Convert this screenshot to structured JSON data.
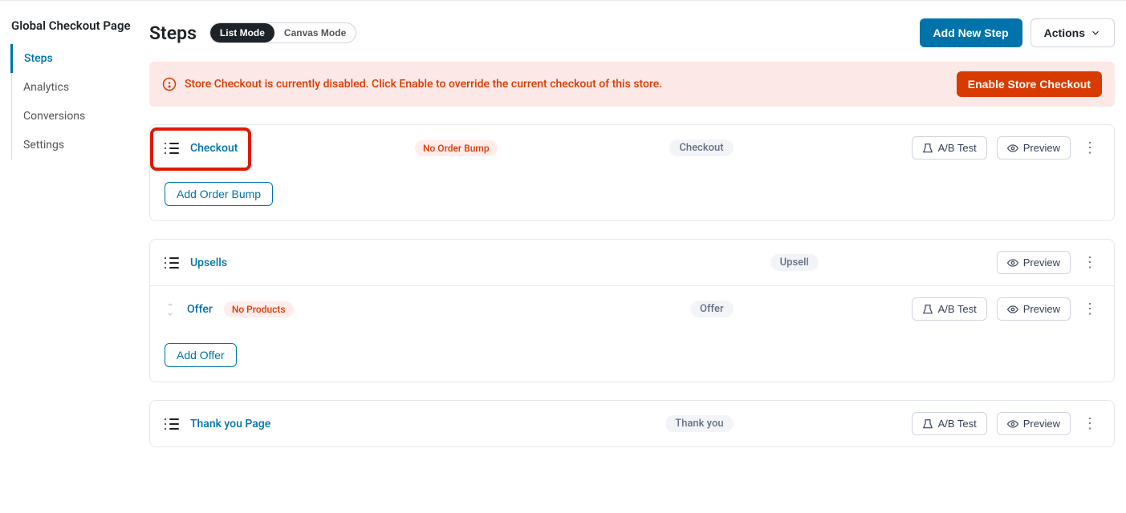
{
  "sidebar": {
    "title": "Global Checkout Page",
    "items": [
      {
        "label": "Steps",
        "active": true
      },
      {
        "label": "Analytics",
        "active": false
      },
      {
        "label": "Conversions",
        "active": false
      },
      {
        "label": "Settings",
        "active": false
      }
    ]
  },
  "header": {
    "title": "Steps",
    "mode_list": "List Mode",
    "mode_canvas": "Canvas Mode",
    "add_new_step": "Add New Step",
    "actions": "Actions"
  },
  "alert": {
    "message": "Store Checkout is currently disabled. Click Enable to override the current checkout of this store.",
    "button": "Enable Store Checkout"
  },
  "buttons": {
    "ab_test": "A/B Test",
    "preview": "Preview",
    "add_order_bump": "Add Order Bump",
    "add_offer": "Add Offer"
  },
  "steps": {
    "checkout": {
      "name": "Checkout",
      "badge": "No Order Bump",
      "tag": "Checkout"
    },
    "upsells": {
      "name": "Upsells",
      "tag": "Upsell"
    },
    "offer": {
      "name": "Offer",
      "badge": "No Products",
      "tag": "Offer"
    },
    "thankyou": {
      "name": "Thank you Page",
      "tag": "Thank you"
    }
  }
}
